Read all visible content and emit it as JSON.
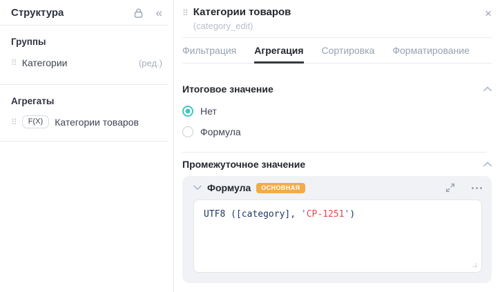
{
  "colors": {
    "accent_teal": "#3ec6c3",
    "badge_orange": "#f3ab49",
    "active_tab_underline": "#33373e",
    "code_text": "#1f3864",
    "code_quote": "#3b6fd4",
    "code_string": "#e5484d"
  },
  "sidebar": {
    "title": "Структура",
    "groups_heading": "Группы",
    "group_item": {
      "label": "Категории",
      "badge": "(ред.)"
    },
    "aggregates_heading": "Агрегаты",
    "aggregate_item": {
      "fx_badge": "F(X)",
      "label": "Категории товаров"
    }
  },
  "panel": {
    "title": "Категории товаров",
    "subtitle": "(category_edit)",
    "close_label": "×",
    "tabs": [
      {
        "label": "Фильтрация",
        "active": false
      },
      {
        "label": "Агрегация",
        "active": true
      },
      {
        "label": "Сортировка",
        "active": false
      },
      {
        "label": "Форматирование",
        "active": false
      }
    ],
    "total_section": {
      "heading": "Итоговое значение",
      "options": [
        {
          "label": "Нет",
          "selected": true
        },
        {
          "label": "Формула",
          "selected": false
        }
      ]
    },
    "intermediate_section": {
      "heading": "Промежуточное значение",
      "formula_card": {
        "title": "Формула",
        "badge": "ОСНОВНАЯ",
        "code_parts": [
          {
            "text": "UTF8 ([category], ",
            "role": "code"
          },
          {
            "text": "'",
            "role": "quote"
          },
          {
            "text": "CP-1251",
            "role": "string"
          },
          {
            "text": "'",
            "role": "quote"
          },
          {
            "text": ")",
            "role": "code"
          }
        ]
      }
    }
  }
}
